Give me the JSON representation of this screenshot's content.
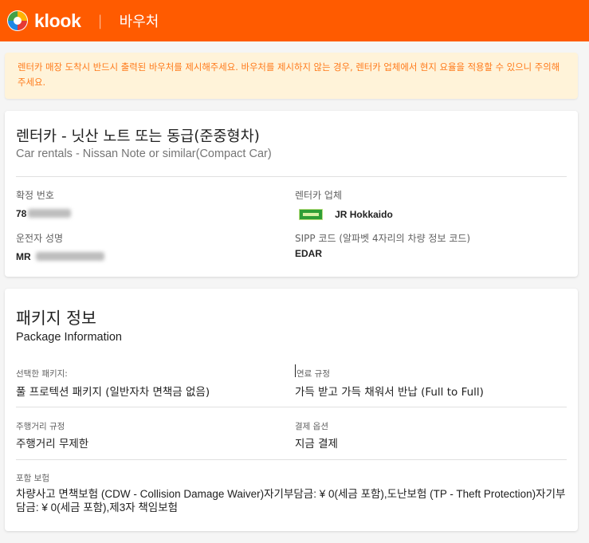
{
  "header": {
    "logo_text": "klook",
    "separator": "|",
    "title": "바우처",
    "brand_color": "#ff5b00"
  },
  "alert": {
    "text": "렌터카 매장 도착시 반드시 출력된 바우처를 제시해주세요. 바우처를 제시하지 않는 경우, 렌터카 업체에서 현지 요율을 적용할 수 있으니 주의해주세요."
  },
  "booking": {
    "title": "렌터카 - 닛산 노트 또는 동급(준중형차)",
    "subtitle": "Car rentals - Nissan Note or similar(Compact Car)",
    "confirmation_label": "확정 번호",
    "confirmation_value": "78",
    "vendor_label": "렌터카 업체",
    "vendor_name": "JR Hokkaido",
    "driver_label": "운전자 성명",
    "driver_value": "MR",
    "sipp_label": "SIPP 코드 (알파벳 4자리의 차량 정보 코드)",
    "sipp_value": "EDAR"
  },
  "package": {
    "title": "패키지 정보",
    "subtitle": "Package Information",
    "selected_label": "선택한 패키지:",
    "selected_value": "풀 프로텍션 패키지 (일반자차 면책금 없음)",
    "fuel_label": "연료 규정",
    "fuel_value": "가득 받고 가득 채워서 반납 (Full to Full)",
    "mileage_label": "주행거리 규정",
    "mileage_value": "주행거리 무제한",
    "payment_label": "결제 옵션",
    "payment_value": "지금 결제",
    "insurance_label": "포함 보험",
    "insurance_value": "차량사고 면책보험 (CDW - Collision Damage Waiver)자기부담금: ¥ 0(세금 포함),도난보험 (TP - Theft Protection)자기부담금: ¥ 0(세금 포함),제3자 책임보험"
  }
}
